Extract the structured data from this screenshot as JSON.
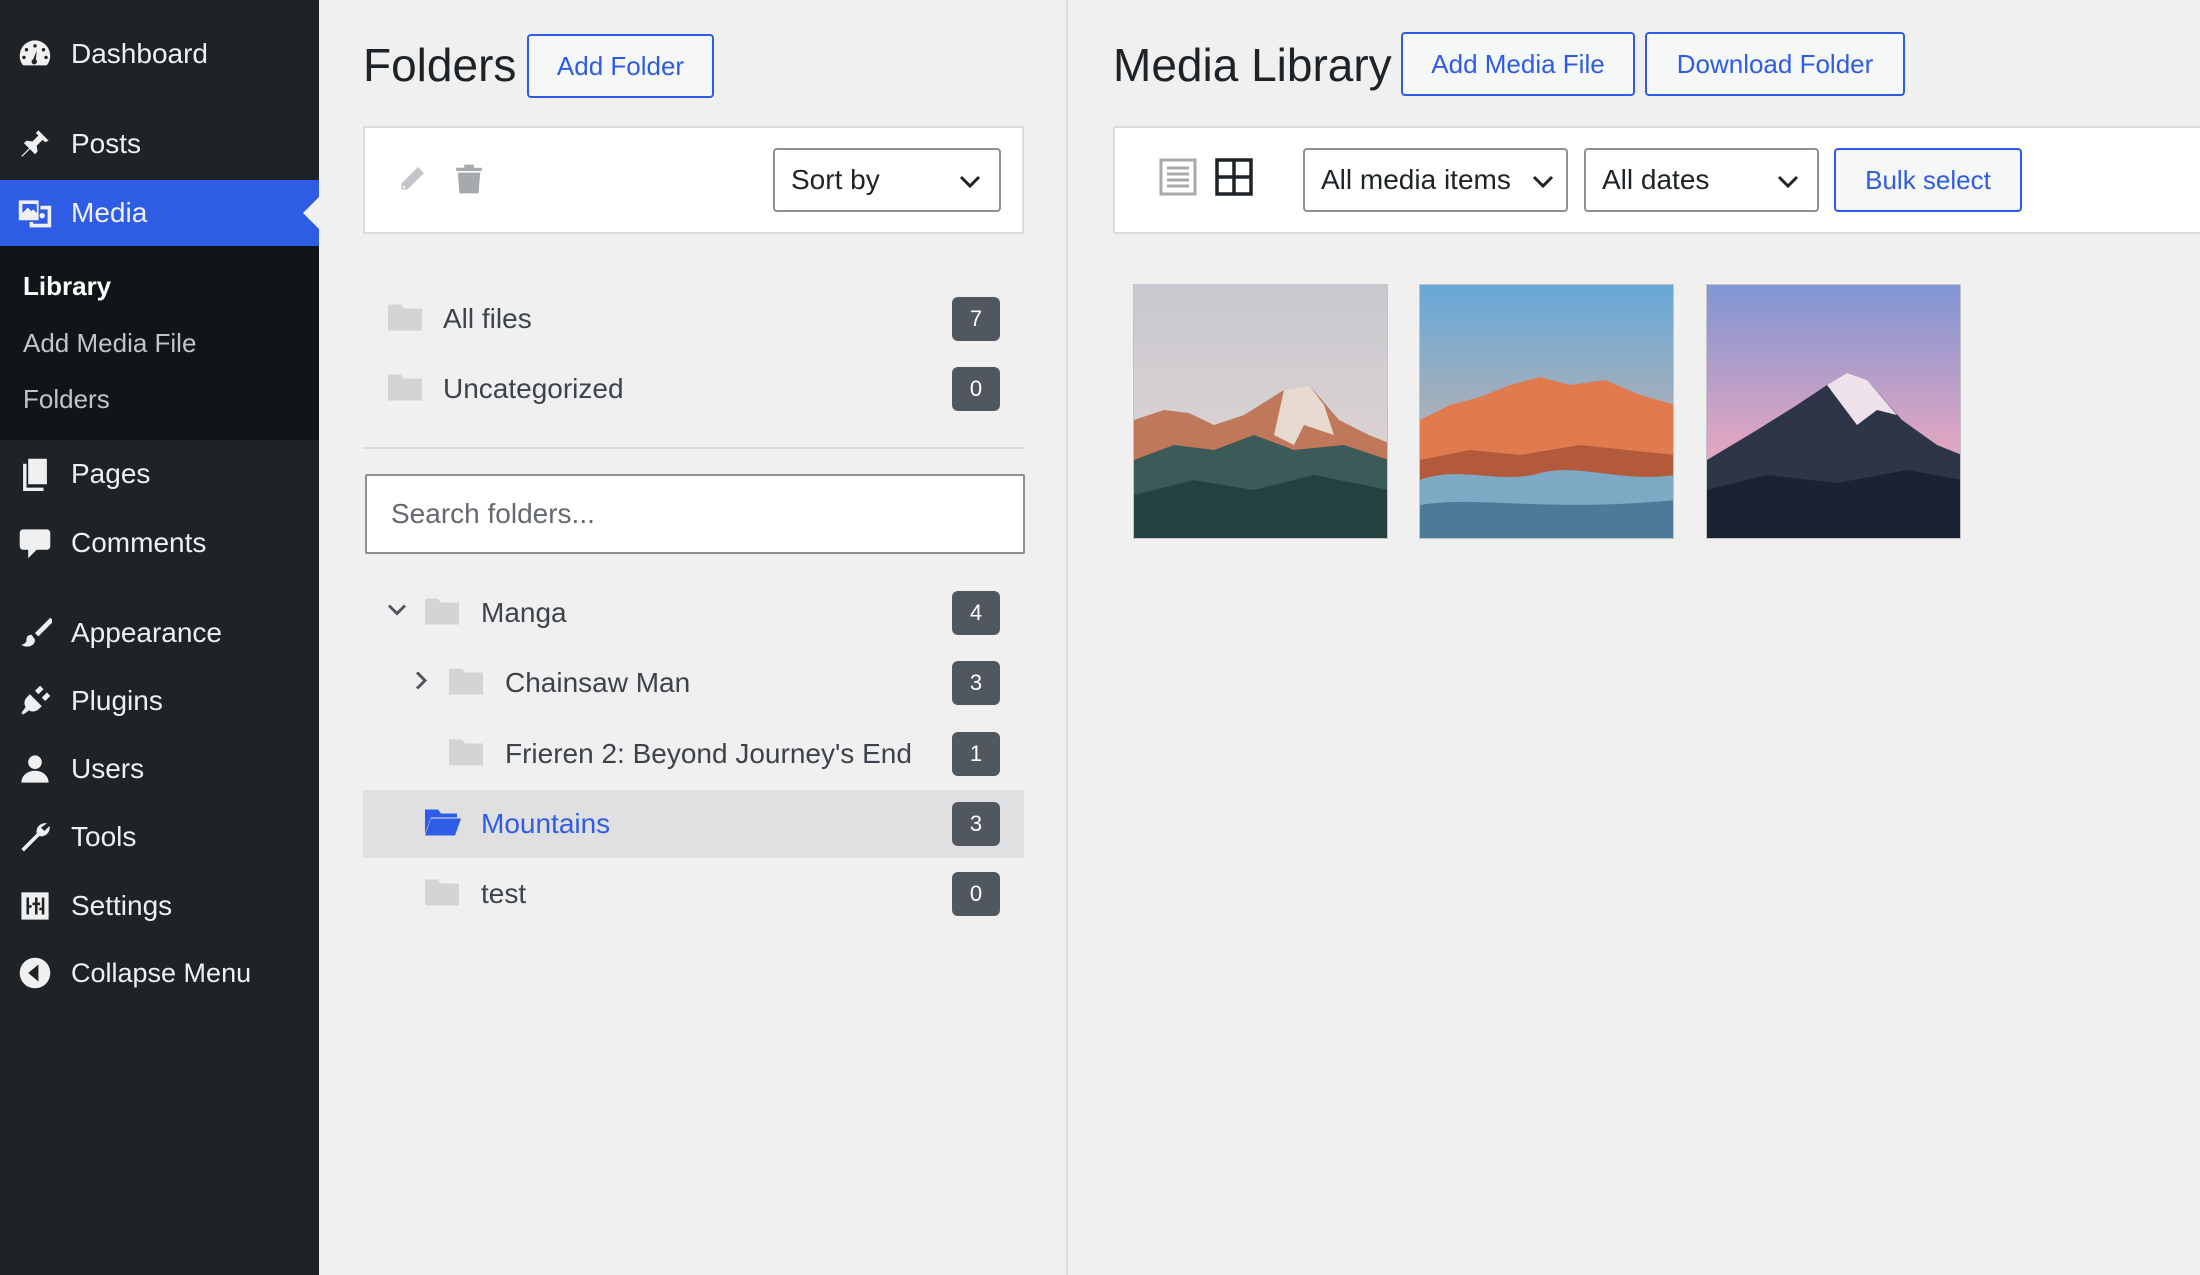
{
  "sidebar": {
    "items": [
      {
        "label": "Dashboard",
        "icon": "dashboard-icon"
      },
      {
        "label": "Posts",
        "icon": "pin-icon"
      },
      {
        "label": "Media",
        "icon": "media-icon"
      },
      {
        "label": "Pages",
        "icon": "pages-icon"
      },
      {
        "label": "Comments",
        "icon": "comment-icon"
      },
      {
        "label": "Appearance",
        "icon": "brush-icon"
      },
      {
        "label": "Plugins",
        "icon": "plugin-icon"
      },
      {
        "label": "Users",
        "icon": "user-icon"
      },
      {
        "label": "Tools",
        "icon": "wrench-icon"
      },
      {
        "label": "Settings",
        "icon": "settings-icon"
      },
      {
        "label": "Collapse Menu",
        "icon": "collapse-icon"
      }
    ],
    "submenu": [
      "Library",
      "Add Media File",
      "Folders"
    ],
    "active": "Media",
    "current_sub": "Library"
  },
  "folders": {
    "title": "Folders",
    "add_label": "Add Folder",
    "sort_label": "Sort by",
    "all_files": {
      "label": "All files",
      "count": "7"
    },
    "uncategorized": {
      "label": "Uncategorized",
      "count": "0"
    },
    "search_placeholder": "Search folders...",
    "tree": [
      {
        "label": "Manga",
        "count": "4"
      },
      {
        "label": "Chainsaw Man",
        "count": "3"
      },
      {
        "label": "Frieren 2: Beyond Journey's End",
        "count": "1"
      },
      {
        "label": "Mountains",
        "count": "3"
      },
      {
        "label": "test",
        "count": "0"
      }
    ],
    "selected": "Mountains"
  },
  "media": {
    "title": "Media Library",
    "add_label": "Add Media File",
    "download_label": "Download Folder",
    "filter_type": "All media items",
    "filter_date": "All dates",
    "bulk_label": "Bulk select",
    "view_icons": [
      "list-view-icon",
      "grid-view-icon"
    ]
  },
  "colors": {
    "accent": "#2f5ce4",
    "sidebar_bg": "#1d2327",
    "badge_bg": "#50575e"
  }
}
